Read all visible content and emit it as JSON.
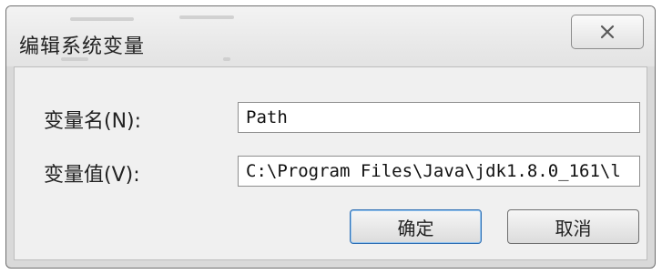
{
  "dialog": {
    "title": "编辑系统变量",
    "close_icon": "close-icon"
  },
  "form": {
    "name_label": "变量名(N):",
    "name_value": "Path",
    "value_label": "变量值(V):",
    "value_value": "C:\\Program Files\\Java\\jdk1.8.0_161\\l"
  },
  "buttons": {
    "ok_label": "确定",
    "cancel_label": "取消"
  }
}
